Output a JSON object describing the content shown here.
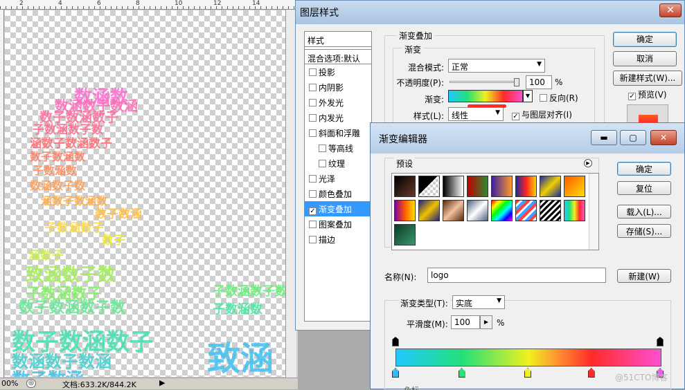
{
  "canvas": {
    "ruler_numbers": [
      "2",
      "4",
      "6",
      "8",
      "10",
      "12",
      "14"
    ],
    "art_words": [
      "数涵数",
      "数涵数子数涵",
      "数子数涵数子",
      "子数涵数子数",
      "涵数子数涵数子",
      "数子数涵数",
      "子数涵数",
      "数涵数子数",
      "涵数子数涵数",
      "数子数涵",
      "子数涵数子",
      "数子",
      "涵数子",
      "致涵数子数",
      "子数涵数子",
      "子数涵数子数",
      "数子数涵数子数",
      "子数涵数",
      "数子数涵数子",
      "数涵数子数涵",
      "数子数涵",
      "致涵"
    ],
    "status": {
      "zoom": "00%",
      "doc": "文档:633.2K/844.2K"
    }
  },
  "layer_style": {
    "title": "图层样式",
    "styles_header": "样式",
    "blend_options": "混合选项:默认",
    "items": [
      {
        "label": "投影",
        "checked": false,
        "sub": false,
        "active": false
      },
      {
        "label": "内阴影",
        "checked": false,
        "sub": false,
        "active": false
      },
      {
        "label": "外发光",
        "checked": false,
        "sub": false,
        "active": false
      },
      {
        "label": "内发光",
        "checked": false,
        "sub": false,
        "active": false
      },
      {
        "label": "斜面和浮雕",
        "checked": false,
        "sub": false,
        "active": false
      },
      {
        "label": "等高线",
        "checked": false,
        "sub": true,
        "active": false
      },
      {
        "label": "纹理",
        "checked": false,
        "sub": true,
        "active": false
      },
      {
        "label": "光泽",
        "checked": false,
        "sub": false,
        "active": false
      },
      {
        "label": "颜色叠加",
        "checked": false,
        "sub": false,
        "active": false
      },
      {
        "label": "渐变叠加",
        "checked": true,
        "sub": false,
        "active": true
      },
      {
        "label": "图案叠加",
        "checked": false,
        "sub": false,
        "active": false
      },
      {
        "label": "描边",
        "checked": false,
        "sub": false,
        "active": false
      }
    ],
    "gradient_overlay": {
      "group_title": "渐变叠加",
      "sub_title": "渐变",
      "blend_mode_label": "混合模式:",
      "blend_mode_value": "正常",
      "opacity_label": "不透明度(P):",
      "opacity_value": "100",
      "opacity_unit": "%",
      "opacity_percent": 100,
      "gradient_label": "渐变:",
      "reverse_label": "反向(R)",
      "style_label": "样式(L):",
      "style_value": "线性",
      "align_label": "与图层对齐(I)"
    },
    "buttons": {
      "ok": "确定",
      "cancel": "取消",
      "new_style": "新建样式(W)...",
      "preview": "预览(V)"
    }
  },
  "gradient_editor": {
    "title": "渐变编辑器",
    "presets_label": "预设",
    "name_label": "名称(N):",
    "name_value": "logo",
    "type_label": "渐变类型(T):",
    "type_value": "实底",
    "smooth_label": "平滑度(M):",
    "smooth_value": "100",
    "smooth_unit": "%",
    "partial_label": "色标",
    "buttons": {
      "ok": "确定",
      "reset": "复位",
      "load": "载入(L)...",
      "save": "存储(S)...",
      "new": "新建(W)"
    },
    "stop_colors": [
      "#3bb6f0",
      "#2fe07a",
      "#f0f020",
      "#ff2a2a",
      "#e066e0"
    ],
    "preset_swatches": [
      "linear-gradient(135deg,#000,#6a3a2a)",
      "linear-gradient(135deg,#000 45%,transparent 46%),repeating-conic-gradient(#ccc 0 25%,#fff 0 50%) 0 0/8px 8px",
      "linear-gradient(90deg,#000,#fff)",
      "linear-gradient(90deg,#c00000,#2e8b2e)",
      "linear-gradient(90deg,#3b1fa0,#ff9a2a)",
      "linear-gradient(90deg,#1a2aa0,#ff2020,#ffd000)",
      "linear-gradient(135deg,#1a2aa0,#f0d000,#1a2aa0)",
      "linear-gradient(135deg,#ff5a00,#ffe000)",
      "linear-gradient(90deg,#7a00a0,#ff5a00,#ffe000)",
      "linear-gradient(135deg,#202080,#f0c000,#202080)",
      "linear-gradient(135deg,#5a2a10,#f0c0a0,#5a2a10)",
      "linear-gradient(135deg,#506080,#fff,#506080)",
      "linear-gradient(135deg,#ff0000,#ffff00,#00ff00,#00ffff,#0000ff,#ff00ff)",
      "repeating-linear-gradient(135deg,#ff4040 0 4px,#fff 4px 7px,#40a0ff 7px 11px)",
      "repeating-linear-gradient(135deg,#000 0 3px,#fff 3px 6px)",
      "linear-gradient(90deg,#22c8ff,#22e07a,#f0f020,#ff2a2a,#ff50d0)",
      "linear-gradient(135deg,#0a3a2a,#3a9a6a)"
    ]
  },
  "watermark": "@51CTO博客"
}
